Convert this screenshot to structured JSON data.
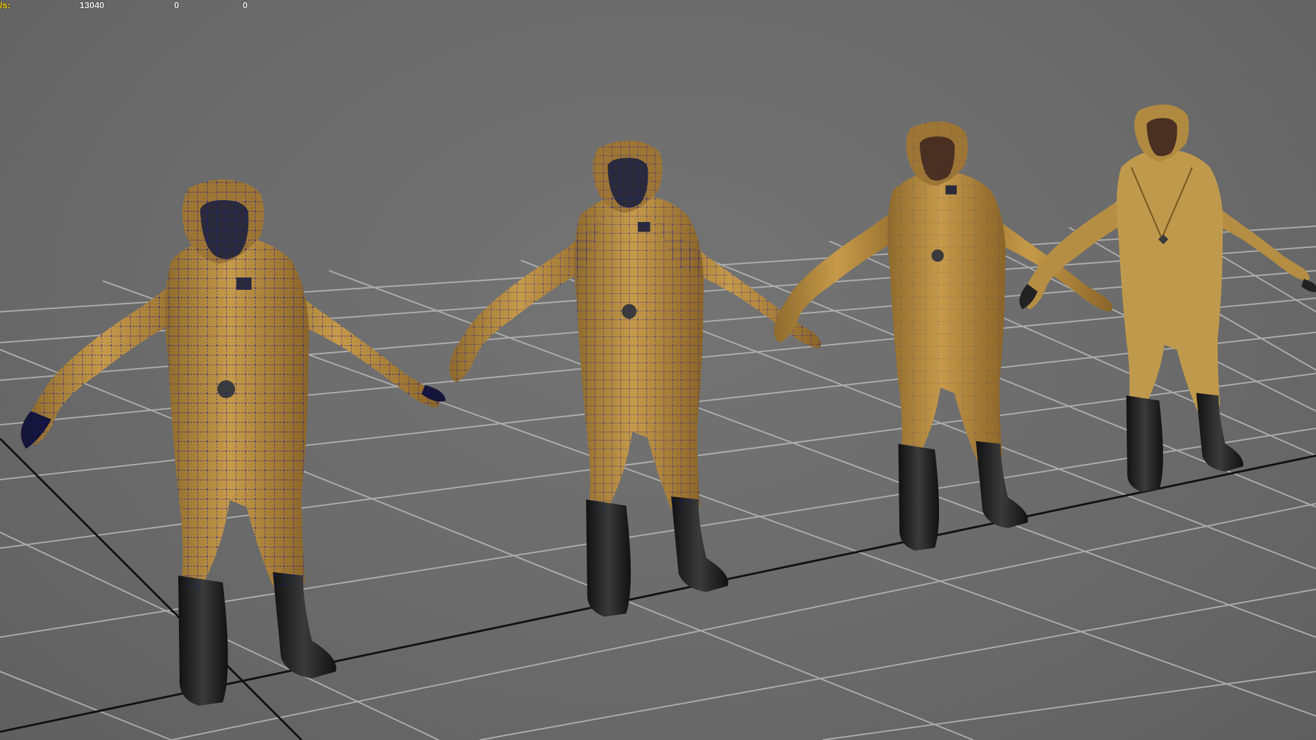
{
  "viewport": {
    "hud": {
      "label": "/s:",
      "values": [
        "13040",
        "0",
        "0"
      ]
    },
    "grid": {
      "visible": true,
      "line_color": "#b9b9b9",
      "axis_color": "#111111"
    },
    "background_color": "#6b6b6b",
    "models": [
      {
        "name": "hazmat-suit-wireframe",
        "suit_color": "#b8893c",
        "wire_color": "#1a1a9a"
      },
      {
        "name": "hazmat-suit-wireframe",
        "suit_color": "#b8893c",
        "wire_color": "#1a1a9a"
      },
      {
        "name": "hazmat-suit-wireframe",
        "suit_color": "#b8893c",
        "wire_color": "#1a1a9a"
      },
      {
        "name": "hazmat-suit-textured",
        "suit_color": "#c09a4c",
        "wire_color": "#1a1a9a"
      }
    ]
  }
}
